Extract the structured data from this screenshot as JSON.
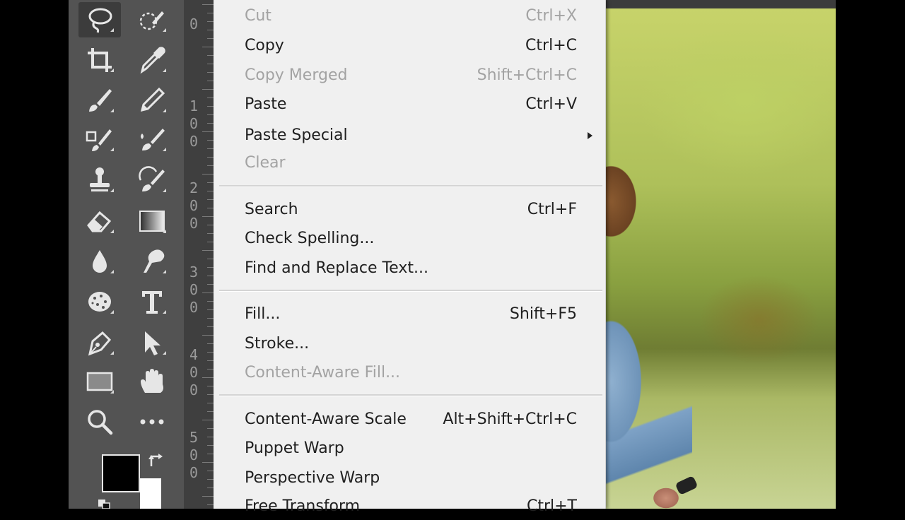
{
  "ruler": {
    "labels": [
      "0",
      "1\n0\n0",
      "2\n0\n0",
      "3\n0\n0",
      "4\n0\n0",
      "5\n0\n0"
    ]
  },
  "toolbar": {
    "tools": [
      {
        "name": "lasso-tool",
        "icon": "lasso-icon",
        "active": true
      },
      {
        "name": "quick-selection-tool",
        "icon": "quick-selection-icon"
      },
      {
        "name": "crop-tool",
        "icon": "crop-icon"
      },
      {
        "name": "eyedropper-tool",
        "icon": "eyedropper-icon"
      },
      {
        "name": "brush-tool",
        "icon": "brush-icon"
      },
      {
        "name": "pencil-tool",
        "icon": "pencil-icon"
      },
      {
        "name": "clone-source-tool",
        "icon": "clone-source-icon"
      },
      {
        "name": "mixer-brush-tool",
        "icon": "mixer-brush-icon"
      },
      {
        "name": "clone-stamp-tool",
        "icon": "stamp-icon"
      },
      {
        "name": "history-brush-tool",
        "icon": "history-brush-icon"
      },
      {
        "name": "eraser-tool",
        "icon": "eraser-icon"
      },
      {
        "name": "gradient-tool",
        "icon": "gradient-icon"
      },
      {
        "name": "blur-tool",
        "icon": "blur-drop-icon"
      },
      {
        "name": "smudge-tool",
        "icon": "smudge-icon"
      },
      {
        "name": "sponge-tool",
        "icon": "sponge-icon"
      },
      {
        "name": "type-tool",
        "icon": "type-icon"
      },
      {
        "name": "pen-tool",
        "icon": "pen-icon"
      },
      {
        "name": "move-select-tool",
        "icon": "arrow-pointer-icon"
      },
      {
        "name": "rectangle-tool",
        "icon": "rectangle-icon"
      },
      {
        "name": "hand-tool",
        "icon": "hand-icon"
      },
      {
        "name": "zoom-tool",
        "icon": "magnifier-icon"
      },
      {
        "name": "more-tools",
        "icon": "ellipsis-icon"
      }
    ],
    "foreground_color": "#000000",
    "background_color": "#ffffff"
  },
  "menu": {
    "items": [
      {
        "label": "Cut",
        "shortcut": "Ctrl+X",
        "disabled": true
      },
      {
        "label": "Copy",
        "shortcut": "Ctrl+C",
        "disabled": false
      },
      {
        "label": "Copy Merged",
        "shortcut": "Shift+Ctrl+C",
        "disabled": true
      },
      {
        "label": "Paste",
        "shortcut": "Ctrl+V",
        "disabled": false
      },
      {
        "label": "Paste Special",
        "shortcut": "",
        "disabled": false,
        "submenu": true
      },
      {
        "label": "Clear",
        "shortcut": "",
        "disabled": true
      },
      {
        "label": "Search",
        "shortcut": "Ctrl+F",
        "disabled": false
      },
      {
        "label": "Check Spelling...",
        "shortcut": "",
        "disabled": false
      },
      {
        "label": "Find and Replace Text...",
        "shortcut": "",
        "disabled": false
      },
      {
        "label": "Fill...",
        "shortcut": "Shift+F5",
        "disabled": false
      },
      {
        "label": "Stroke...",
        "shortcut": "",
        "disabled": false
      },
      {
        "label": "Content-Aware Fill...",
        "shortcut": "",
        "disabled": true
      },
      {
        "label": "Content-Aware Scale",
        "shortcut": "Alt+Shift+Ctrl+C",
        "disabled": false
      },
      {
        "label": "Puppet Warp",
        "shortcut": "",
        "disabled": false
      },
      {
        "label": "Perspective Warp",
        "shortcut": "",
        "disabled": false
      },
      {
        "label": "Free Transform",
        "shortcut": "Ctrl+T",
        "disabled": false
      }
    ]
  },
  "colors": {
    "panel": "#535353",
    "menu_bg": "#f0f0f0",
    "menu_text": "#202020",
    "menu_disabled": "#a3a3a3"
  }
}
